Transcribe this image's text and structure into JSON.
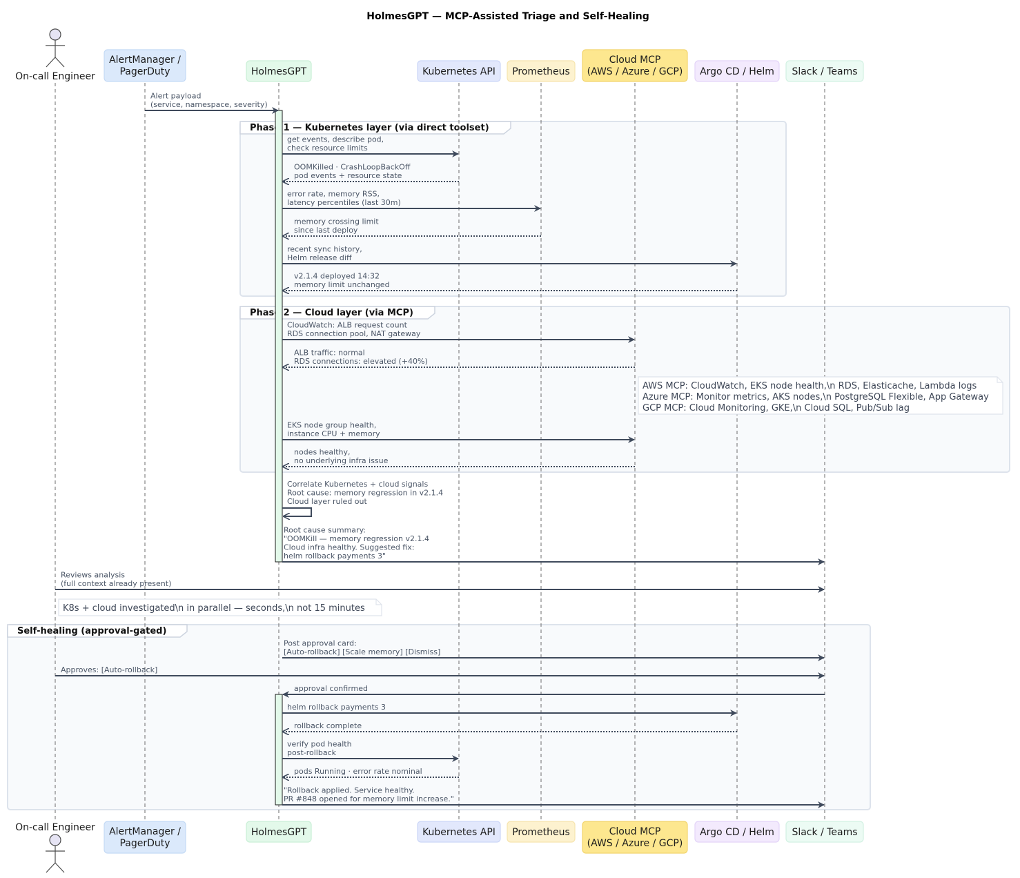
{
  "title": "HolmesGPT — MCP-Assisted Triage and Self-Healing",
  "participants": [
    {
      "id": "eng",
      "lines": [
        "On-call Engineer"
      ],
      "kind": "actor",
      "fill": "#e6e4f4",
      "stroke": "#4b4b4b"
    },
    {
      "id": "am",
      "lines": [
        "AlertManager /",
        "PagerDuty"
      ],
      "kind": "box",
      "fill": "#dbe9fb",
      "stroke": "#c4daf5"
    },
    {
      "id": "hg",
      "lines": [
        "HolmesGPT"
      ],
      "kind": "box",
      "fill": "#e3f9ea",
      "stroke": "#c9efd6"
    },
    {
      "id": "k8s",
      "lines": [
        "Kubernetes API"
      ],
      "kind": "box",
      "fill": "#e2e8fc",
      "stroke": "#cbd6f7"
    },
    {
      "id": "prom",
      "lines": [
        "Prometheus"
      ],
      "kind": "box",
      "fill": "#fdf2cf",
      "stroke": "#f6e4ae"
    },
    {
      "id": "cloud",
      "lines": [
        "Cloud MCP",
        "(AWS / Azure / GCP)"
      ],
      "kind": "box",
      "fill": "#fde78f",
      "stroke": "#f2d46d"
    },
    {
      "id": "argo",
      "lines": [
        "Argo CD / Helm"
      ],
      "kind": "box",
      "fill": "#f3eafd",
      "stroke": "#e3d4f8"
    },
    {
      "id": "slack",
      "lines": [
        "Slack / Teams"
      ],
      "kind": "box",
      "fill": "#ecfbf4",
      "stroke": "#d2f1e2"
    }
  ],
  "groups": [
    {
      "label": "Phase 1 — Kubernetes layer (via direct toolset)"
    },
    {
      "label": "Phase 2 — Cloud layer (via MCP)"
    },
    {
      "label": "Self-healing (approval-gated)"
    }
  ],
  "messages": [
    {
      "from": "am",
      "to": "hg",
      "style": "solid",
      "lines": [
        "Alert payload",
        "(service, namespace, severity)"
      ]
    },
    {
      "from": "hg",
      "to": "k8s",
      "style": "solid",
      "lines": [
        "get events, describe pod,",
        "check resource limits"
      ]
    },
    {
      "from": "k8s",
      "to": "hg",
      "style": "dotted",
      "lines": [
        "OOMKilled · CrashLoopBackOff",
        "pod events + resource state"
      ]
    },
    {
      "from": "hg",
      "to": "prom",
      "style": "solid",
      "lines": [
        "error rate, memory RSS,",
        "latency percentiles (last 30m)"
      ]
    },
    {
      "from": "prom",
      "to": "hg",
      "style": "dotted",
      "lines": [
        "memory crossing limit",
        "since last deploy"
      ]
    },
    {
      "from": "hg",
      "to": "argo",
      "style": "solid",
      "lines": [
        "recent sync history,",
        "Helm release diff"
      ]
    },
    {
      "from": "argo",
      "to": "hg",
      "style": "dotted",
      "lines": [
        "v2.1.4 deployed 14:32",
        "memory limit unchanged"
      ]
    },
    {
      "from": "hg",
      "to": "cloud",
      "style": "solid",
      "lines": [
        "CloudWatch: ALB request count",
        "RDS connection pool, NAT gateway"
      ]
    },
    {
      "from": "cloud",
      "to": "hg",
      "style": "dotted",
      "lines": [
        "ALB traffic: normal",
        "RDS connections: elevated (+40%)"
      ]
    },
    {
      "from": "hg",
      "to": "cloud",
      "style": "solid",
      "lines": [
        "EKS node group health,",
        "instance CPU + memory"
      ]
    },
    {
      "from": "cloud",
      "to": "hg",
      "style": "dotted",
      "lines": [
        "nodes healthy,",
        "no underlying infra issue"
      ]
    },
    {
      "from": "hg",
      "to": "hg",
      "style": "self",
      "lines": [
        "Correlate Kubernetes + cloud signals",
        "Root cause: memory regression in v2.1.4",
        "Cloud layer ruled out"
      ]
    },
    {
      "from": "hg",
      "to": "slack",
      "style": "solid",
      "lines": [
        "Root cause summary:",
        "\"OOMKill — memory regression v2.1.4",
        "Cloud infra healthy. Suggested fix:",
        "helm rollback payments 3\""
      ]
    },
    {
      "from": "eng",
      "to": "slack",
      "style": "solid",
      "lines": [
        "Reviews analysis",
        "(full context already present)"
      ]
    },
    {
      "from": "hg",
      "to": "slack",
      "style": "solid",
      "lines": [
        "Post approval card:",
        "[Auto-rollback] [Scale memory] [Dismiss]"
      ]
    },
    {
      "from": "eng",
      "to": "slack",
      "style": "solid",
      "lines": [
        "Approves: [Auto-rollback]"
      ]
    },
    {
      "from": "slack",
      "to": "hg",
      "style": "solid",
      "lines": [
        "approval confirmed"
      ]
    },
    {
      "from": "hg",
      "to": "argo",
      "style": "solid",
      "lines": [
        "helm rollback payments 3"
      ]
    },
    {
      "from": "argo",
      "to": "hg",
      "style": "dotted",
      "lines": [
        "rollback complete"
      ]
    },
    {
      "from": "hg",
      "to": "k8s",
      "style": "solid",
      "lines": [
        "verify pod health",
        "post-rollback"
      ]
    },
    {
      "from": "k8s",
      "to": "hg",
      "style": "dotted",
      "lines": [
        "pods Running · error rate nominal"
      ]
    },
    {
      "from": "hg",
      "to": "slack",
      "style": "solid",
      "lines": [
        "\"Rollback applied. Service healthy.",
        "PR #848 opened for memory limit increase.\""
      ]
    }
  ],
  "notes": [
    {
      "lines": [
        "AWS MCP: CloudWatch, EKS node health,\\n  RDS, Elasticache, Lambda logs",
        "Azure MCP: Monitor metrics, AKS nodes,\\n  PostgreSQL Flexible, App Gateway",
        "GCP MCP: Cloud Monitoring, GKE,\\n  Cloud SQL, Pub/Sub lag"
      ]
    },
    {
      "lines": [
        "K8s + cloud investigated\\n  in parallel — seconds,\\n  not 15 minutes"
      ]
    }
  ],
  "colors": {
    "arrow": "#3f4a5c",
    "message_text": "#4a5566",
    "group_fill": "#f8fafc",
    "group_stroke": "#dde3ec",
    "activation_fill": "#e3f9ea",
    "note_fill": "#ffffff",
    "note_stroke": "#dfe4ec"
  }
}
